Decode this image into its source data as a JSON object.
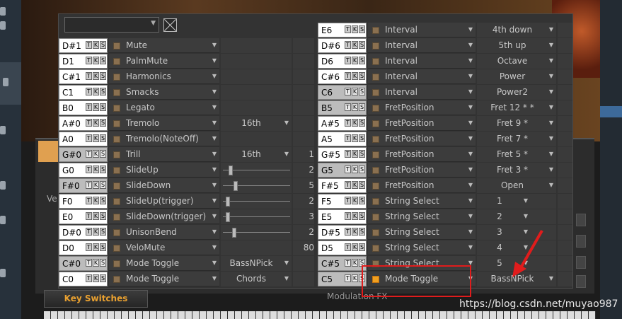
{
  "watermark": "https://blog.csdn.net/muyao987",
  "lower": {
    "key_switches": "Key Switches",
    "modulation_fx": "Modulation FX",
    "ve": "Ve"
  },
  "tks": [
    "T",
    "K",
    "S"
  ],
  "left_rows": [
    {
      "note": "D#1",
      "func": "Mute",
      "p1": "",
      "p2": "",
      "slider": null
    },
    {
      "note": "D1",
      "func": "PalmMute",
      "p1": "",
      "p2": "",
      "slider": null
    },
    {
      "note": "C#1",
      "func": "Harmonics",
      "p1": "",
      "p2": "",
      "slider": null
    },
    {
      "note": "C1",
      "func": "Smacks",
      "p1": "",
      "p2": "",
      "slider": null
    },
    {
      "note": "B0",
      "func": "Legato",
      "p1": "",
      "p2": "",
      "slider": null
    },
    {
      "note": "A#0",
      "func": "Tremolo",
      "p1": "16th",
      "p2": "",
      "slider": null
    },
    {
      "note": "A0",
      "func": "Tremolo(NoteOff)",
      "p1": "",
      "p2": "",
      "slider": null
    },
    {
      "note": "G#0",
      "func": "Trill",
      "p1": "16th",
      "p2": "1",
      "slider": null
    },
    {
      "note": "G0",
      "func": "SlideUp",
      "p1": "",
      "p2": "2",
      "slider": 0.08
    },
    {
      "note": "F#0",
      "func": "SlideDown",
      "p1": "",
      "p2": "5",
      "slider": 0.16
    },
    {
      "note": "F0",
      "func": "SlideUp(trigger)",
      "p1": "",
      "p2": "2",
      "slider": 0.04
    },
    {
      "note": "E0",
      "func": "SlideDown(trigger)",
      "p1": "",
      "p2": "3",
      "slider": 0.04
    },
    {
      "note": "D#0",
      "func": "UnisonBend",
      "p1": "",
      "p2": "2",
      "slider": 0.14
    },
    {
      "note": "D0",
      "func": "VeloMute",
      "p1": "",
      "p2": "80",
      "slider": null
    },
    {
      "note": "C#0",
      "func": "Mode Toggle",
      "p1": "BassNPick",
      "p2": "",
      "slider": null
    },
    {
      "note": "C0",
      "func": "Mode Toggle",
      "p1": "Chords",
      "p2": "",
      "slider": null
    }
  ],
  "right_rows": [
    {
      "note": "E6",
      "func": "Interval",
      "p1": "4th down",
      "narrow": false
    },
    {
      "note": "D#6",
      "func": "Interval",
      "p1": "5th up",
      "narrow": false
    },
    {
      "note": "D6",
      "func": "Interval",
      "p1": "Octave",
      "narrow": false
    },
    {
      "note": "C#6",
      "func": "Interval",
      "p1": "Power",
      "narrow": false
    },
    {
      "note": "C6",
      "func": "Interval",
      "p1": "Power2",
      "narrow": false
    },
    {
      "note": "B5",
      "func": "FretPosition",
      "p1": "Fret 12 * *",
      "narrow": false
    },
    {
      "note": "A#5",
      "func": "FretPosition",
      "p1": "Fret 9   *",
      "narrow": false
    },
    {
      "note": "A5",
      "func": "FretPosition",
      "p1": "Fret 7   *",
      "narrow": false
    },
    {
      "note": "G#5",
      "func": "FretPosition",
      "p1": "Fret 5   *",
      "narrow": false
    },
    {
      "note": "G5",
      "func": "FretPosition",
      "p1": "Fret 3   *",
      "narrow": false
    },
    {
      "note": "F#5",
      "func": "FretPosition",
      "p1": "Open",
      "narrow": false
    },
    {
      "note": "F5",
      "func": "String Select",
      "p1": "1",
      "narrow": true
    },
    {
      "note": "E5",
      "func": "String Select",
      "p1": "2",
      "narrow": true
    },
    {
      "note": "D#5",
      "func": "String Select",
      "p1": "3",
      "narrow": true
    },
    {
      "note": "D5",
      "func": "String Select",
      "p1": "4",
      "narrow": true
    },
    {
      "note": "C#5",
      "func": "String Select",
      "p1": "5",
      "narrow": true
    },
    {
      "note": "C5",
      "func": "Mode Toggle",
      "p1": "BassNPick",
      "narrow": false,
      "checked": true
    }
  ]
}
